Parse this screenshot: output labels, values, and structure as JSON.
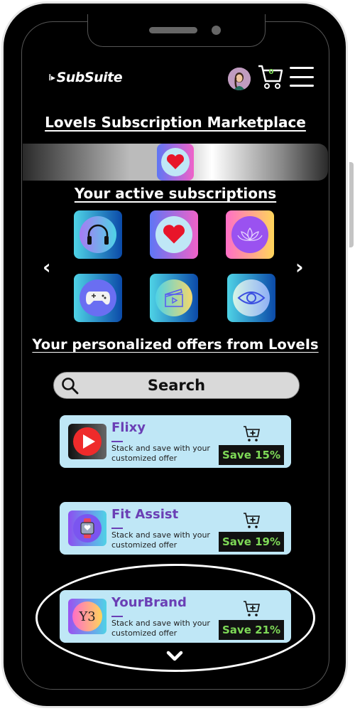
{
  "header": {
    "logo_text": "SubSuite",
    "cart_count": "0",
    "icons": [
      "avatar",
      "cart-icon",
      "hamburger-menu-icon"
    ]
  },
  "marketplace_title": "LoveIs Subscription Marketplace",
  "banner": {
    "icon": "heart-icon"
  },
  "active_subscriptions": {
    "title": "Your active subscriptions",
    "items": [
      {
        "icon": "headphones-icon"
      },
      {
        "icon": "heart-icon"
      },
      {
        "icon": "lotus-icon"
      },
      {
        "icon": "game-controller-icon"
      },
      {
        "icon": "clapperboard-icon"
      },
      {
        "icon": "eye-icon"
      }
    ],
    "prev_icon": "chevron-left-icon",
    "next_icon": "chevron-right-icon"
  },
  "offers": {
    "title": "Your personalized offers from LoveIs",
    "search_placeholder": "Search",
    "items": [
      {
        "name": "Flixy",
        "description": "Stack and save with your customized offer",
        "save": "Save 15%",
        "icon": "play-icon"
      },
      {
        "name": "Fit Assist",
        "description": "Stack and save with your customized offer",
        "save": "Save 19%",
        "icon": "smartwatch-icon"
      },
      {
        "name": "YourBrand",
        "description": "Stack and save with your customized offer",
        "save": "Save 21%",
        "icon": "yourbrand-logo-icon"
      }
    ],
    "more_icon": "chevron-down-icon"
  },
  "colors": {
    "offer_card_bg": "#bfe7f6",
    "offer_name": "#6a3fb5",
    "save_text": "#7ed957",
    "save_bg": "#111111"
  }
}
